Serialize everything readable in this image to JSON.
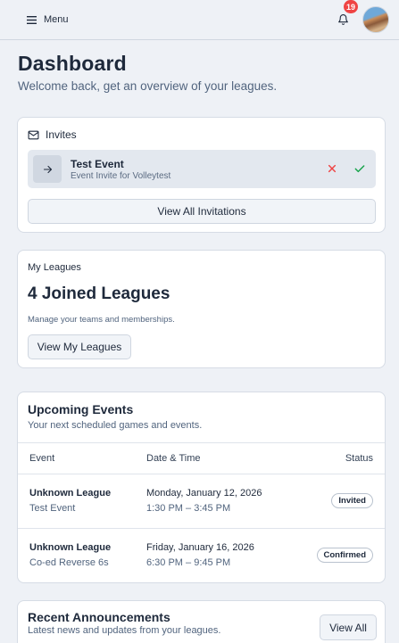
{
  "topbar": {
    "menu_label": "Menu",
    "notification_count": "19"
  },
  "header": {
    "title": "Dashboard",
    "subtitle": "Welcome back, get an overview of your leagues."
  },
  "invites": {
    "heading": "Invites",
    "items": [
      {
        "title": "Test Event",
        "subtitle": "Event Invite for Volleytest"
      }
    ],
    "view_all_label": "View All Invitations"
  },
  "leagues": {
    "label": "My Leagues",
    "count_text": "4 Joined Leagues",
    "description": "Manage your teams and memberships.",
    "button_label": "View My Leagues"
  },
  "events": {
    "title": "Upcoming Events",
    "subtitle": "Your next scheduled games and events.",
    "columns": [
      "Event",
      "Date & Time",
      "Status"
    ],
    "rows": [
      {
        "league": "Unknown League",
        "event": "Test Event",
        "date": "Monday, January 12, 2026",
        "time": "1:30 PM – 3:45 PM",
        "status": "Invited"
      },
      {
        "league": "Unknown League",
        "event": "Co-ed Reverse 6s",
        "date": "Friday, January 16, 2026",
        "time": "6:30 PM – 9:45 PM",
        "status": "Confirmed"
      }
    ]
  },
  "announcements": {
    "title": "Recent Announcements",
    "subtitle": "Latest news and updates from your leagues.",
    "button_label": "View All"
  },
  "colors": {
    "background": "#eef1f6",
    "badge": "#ef4444",
    "decline": "#ef4444",
    "accept": "#16a34a"
  },
  "icons": {
    "menu": "hamburger-icon",
    "notifications": "bell-icon",
    "invites": "mail-icon",
    "invite_item": "arrow-right-icon",
    "decline": "x-icon",
    "accept": "check-icon"
  }
}
